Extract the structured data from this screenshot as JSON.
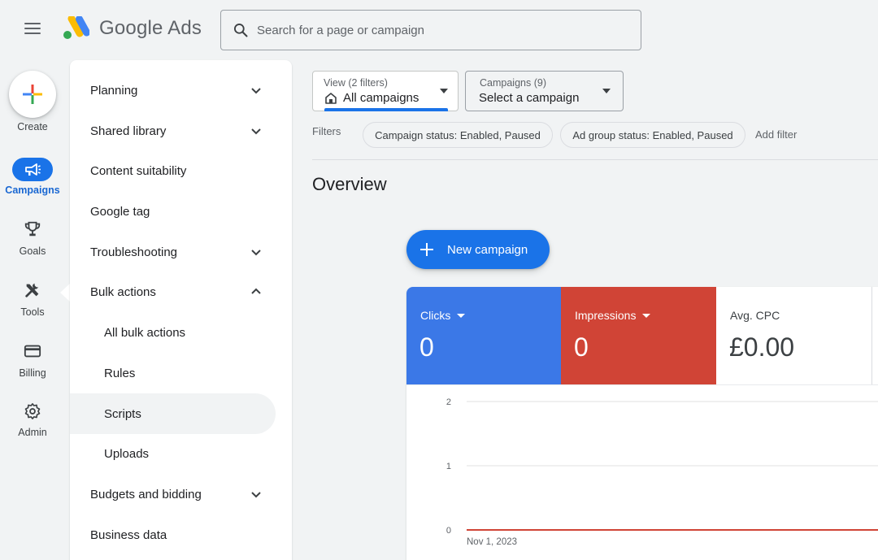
{
  "header": {
    "brand": "Google Ads",
    "search_placeholder": "Search for a page or campaign"
  },
  "rail": {
    "items": [
      {
        "label": "Create",
        "icon": "plus-icon"
      },
      {
        "label": "Campaigns",
        "icon": "megaphone-icon",
        "active": true
      },
      {
        "label": "Goals",
        "icon": "trophy-icon"
      },
      {
        "label": "Tools",
        "icon": "tools-icon"
      },
      {
        "label": "Billing",
        "icon": "credit-card-icon"
      },
      {
        "label": "Admin",
        "icon": "gear-icon"
      }
    ]
  },
  "nav": {
    "items": [
      {
        "label": "Planning",
        "expandable": true,
        "expanded": false
      },
      {
        "label": "Shared library",
        "expandable": true,
        "expanded": false
      },
      {
        "label": "Content suitability",
        "expandable": false
      },
      {
        "label": "Google tag",
        "expandable": false
      },
      {
        "label": "Troubleshooting",
        "expandable": true,
        "expanded": false
      },
      {
        "label": "Bulk actions",
        "expandable": true,
        "expanded": true
      },
      {
        "label": "All bulk actions",
        "sub": true
      },
      {
        "label": "Rules",
        "sub": true
      },
      {
        "label": "Scripts",
        "sub": true,
        "active": true
      },
      {
        "label": "Uploads",
        "sub": true
      },
      {
        "label": "Budgets and bidding",
        "expandable": true,
        "expanded": false
      },
      {
        "label": "Business data",
        "expandable": false
      }
    ]
  },
  "selectors": {
    "view": {
      "caption": "View (2 filters)",
      "value": "All campaigns"
    },
    "campaigns": {
      "caption": "Campaigns (9)",
      "value": "Select a campaign"
    }
  },
  "filters": {
    "label": "Filters",
    "chips": [
      "Campaign status: Enabled, Paused",
      "Ad group status: Enabled, Paused"
    ],
    "add_filter": "Add filter"
  },
  "main": {
    "title": "Overview",
    "new_campaign_label": "New campaign"
  },
  "metrics": [
    {
      "name": "Clicks",
      "value": "0",
      "color": "#3b78e7",
      "dropdown": true
    },
    {
      "name": "Impressions",
      "value": "0",
      "color": "#d04436",
      "dropdown": true
    },
    {
      "name": "Avg. CPC",
      "value": "£0.00",
      "color": "#ffffff",
      "dropdown": false
    }
  ],
  "chart_data": {
    "type": "line",
    "x": [
      "Nov 1, 2023"
    ],
    "ylim": [
      0,
      2
    ],
    "yticks": [
      "2",
      "1",
      "0"
    ],
    "series": [
      {
        "values": [
          0
        ],
        "color": "#d04436"
      }
    ],
    "grid": true
  },
  "colors": {
    "accent": "#1a73e8",
    "clicks": "#3b78e7",
    "impressions": "#d04436"
  }
}
